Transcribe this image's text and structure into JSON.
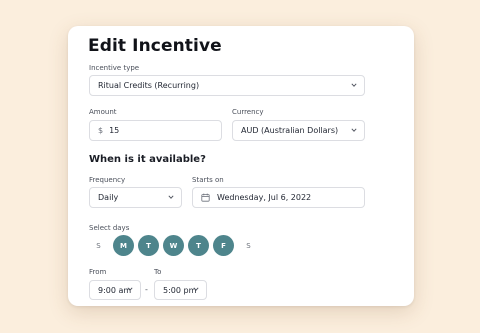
{
  "title": "Edit Incentive",
  "incentive_type": {
    "label": "Incentive type",
    "value": "Ritual Credits (Recurring)",
    "icon": "chevron-down-icon"
  },
  "amount": {
    "label": "Amount",
    "prefix": "$",
    "value": "15"
  },
  "currency": {
    "label": "Currency",
    "value": "AUD (Australian Dollars)",
    "icon": "chevron-down-icon"
  },
  "availability": {
    "heading": "When is it available?",
    "frequency": {
      "label": "Frequency",
      "value": "Daily",
      "icon": "chevron-down-icon"
    },
    "starts_on": {
      "label": "Starts on",
      "value": "Wednesday, Jul 6, 2022",
      "icon": "calendar-icon"
    }
  },
  "select_days": {
    "label": "Select days",
    "days": [
      {
        "letter": "S",
        "selected": false
      },
      {
        "letter": "M",
        "selected": true
      },
      {
        "letter": "T",
        "selected": true
      },
      {
        "letter": "W",
        "selected": true
      },
      {
        "letter": "T",
        "selected": true
      },
      {
        "letter": "F",
        "selected": true
      },
      {
        "letter": "S",
        "selected": false
      }
    ]
  },
  "time_range": {
    "from_label": "From",
    "to_label": "To",
    "from_value": "9:00 am",
    "to_value": "5:00 pm",
    "separator": "-"
  },
  "colors": {
    "background": "#fbeedd",
    "selected_day": "#4e858c",
    "card": "#ffffff",
    "border": "#dcdde2"
  }
}
